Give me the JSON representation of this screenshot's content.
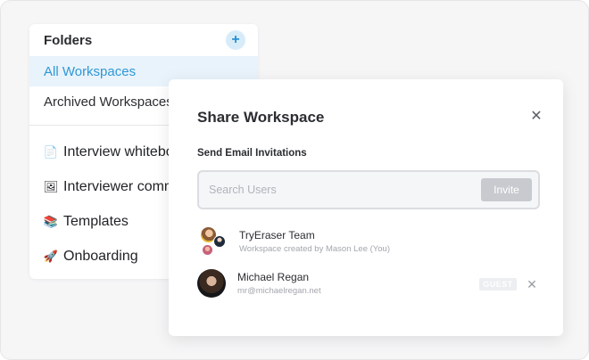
{
  "folders": {
    "title": "Folders",
    "add_icon": "plus-icon",
    "items": [
      {
        "label": "All Workspaces",
        "active": true
      },
      {
        "label": "Archived Workspaces",
        "active": false
      }
    ]
  },
  "workspaces": [
    {
      "icon": "document-icon",
      "emoji": "📄",
      "label": "Interview whiteboard"
    },
    {
      "icon": "picture-icon",
      "emoji": "🖼",
      "label": "Interviewer comments"
    },
    {
      "icon": "books-icon",
      "emoji": "📚",
      "label": "Templates"
    },
    {
      "icon": "rocket-icon",
      "emoji": "🚀",
      "label": "Onboarding"
    }
  ],
  "modal": {
    "title": "Share Workspace",
    "close_icon": "close-icon",
    "section_label": "Send Email Invitations",
    "search_placeholder": "Search Users",
    "invite_label": "Invite",
    "members": [
      {
        "name": "TryEraser Team",
        "subtitle": "Workspace created by Mason Lee (You)"
      },
      {
        "name": "Michael Regan",
        "subtitle": "mr@michaelregan.net",
        "badge": "GUEST"
      }
    ]
  },
  "colors": {
    "accent": "#2f97d6",
    "active_bg": "#e9f3fb",
    "invite_disabled": "#c8cacf"
  }
}
